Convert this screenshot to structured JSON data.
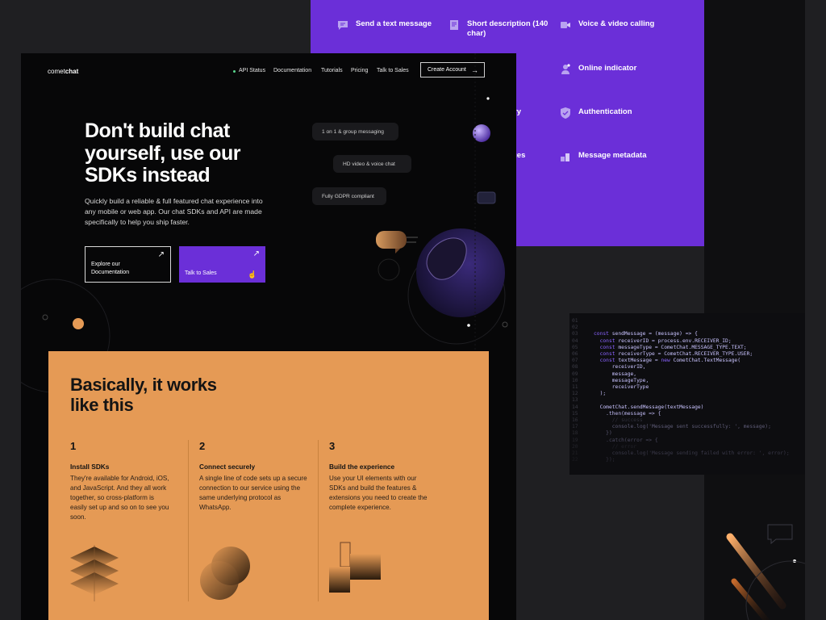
{
  "features": {
    "send_text": "Send a text message",
    "short_desc": "Short description (140 char)",
    "voice_video": "Voice & video calling",
    "online": "Online indicator",
    "auth": "Authentication",
    "metadata": "Message metadata",
    "partial_1": "ry",
    "partial_2": "ges"
  },
  "header": {
    "logo_light": "comet",
    "logo_bold": "chat",
    "nav": [
      "API Status",
      "Documentation",
      "Tutorials",
      "Pricing",
      "Talk to Sales"
    ],
    "create_account": "Create Account"
  },
  "hero": {
    "headline": "Don't build chat yourself, use our SDKs instead",
    "subtitle": "Quickly build a reliable & full featured chat experience into any mobile or web app. Our chat SDKs and API are made specifically to help you ship faster.",
    "btn_docs": "Explore our Documentation",
    "btn_sales": "Talk to Sales",
    "bubbles": [
      "1 on 1 & group messaging",
      "HD video & voice chat",
      "Fully GDPR compliant"
    ]
  },
  "how": {
    "title": "Basically, it works like this",
    "steps": [
      {
        "num": "1",
        "title": "Install SDKs",
        "desc": "They're available for Android, iOS, and JavaScript. And they all work together, so cross-platform is easily set up and so on to see you soon."
      },
      {
        "num": "2",
        "title": "Connect securely",
        "desc": "A single line of code sets up a secure connection to our service using the same underlying protocol as WhatsApp."
      },
      {
        "num": "3",
        "title": "Build the experience",
        "desc": "Use your UI elements with our SDKs and build the features & extensions you need to create the complete experience."
      }
    ]
  },
  "code": {
    "lines": [
      {
        "n": "01",
        "t": ""
      },
      {
        "n": "02",
        "t": ""
      },
      {
        "n": "03",
        "t": "const sendMessage = (message) => {"
      },
      {
        "n": "04",
        "t": "  const receiverID = process.env.RECEIVER_ID;"
      },
      {
        "n": "05",
        "t": "  const messageType = CometChat.MESSAGE_TYPE.TEXT;"
      },
      {
        "n": "06",
        "t": "  const receiverType = CometChat.RECEIVER_TYPE.USER;"
      },
      {
        "n": "07",
        "t": "  const textMessage = new CometChat.TextMessage("
      },
      {
        "n": "08",
        "t": "      receiverID,"
      },
      {
        "n": "09",
        "t": "      message,"
      },
      {
        "n": "10",
        "t": "      messageType,"
      },
      {
        "n": "11",
        "t": "      receiverType"
      },
      {
        "n": "12",
        "t": "  );"
      },
      {
        "n": "13",
        "t": ""
      },
      {
        "n": "14",
        "t": "  CometChat.sendMessage(textMessage)"
      },
      {
        "n": "15",
        "t": "    .then(message => {"
      },
      {
        "n": "16",
        "t": "      // success"
      },
      {
        "n": "17",
        "t": "      console.log('Message sent successfully: ', message);"
      },
      {
        "n": "18",
        "t": "    })"
      },
      {
        "n": "19",
        "t": "    .catch(error => {"
      },
      {
        "n": "20",
        "t": "      // error"
      },
      {
        "n": "21",
        "t": "      console.log('Message sending failed with error: ', error);"
      },
      {
        "n": "22",
        "t": "    });"
      }
    ]
  },
  "colors": {
    "purple": "#6b2fd8",
    "orange": "#e59a55",
    "black": "#070708",
    "code_keyword": "#8a63ff"
  }
}
